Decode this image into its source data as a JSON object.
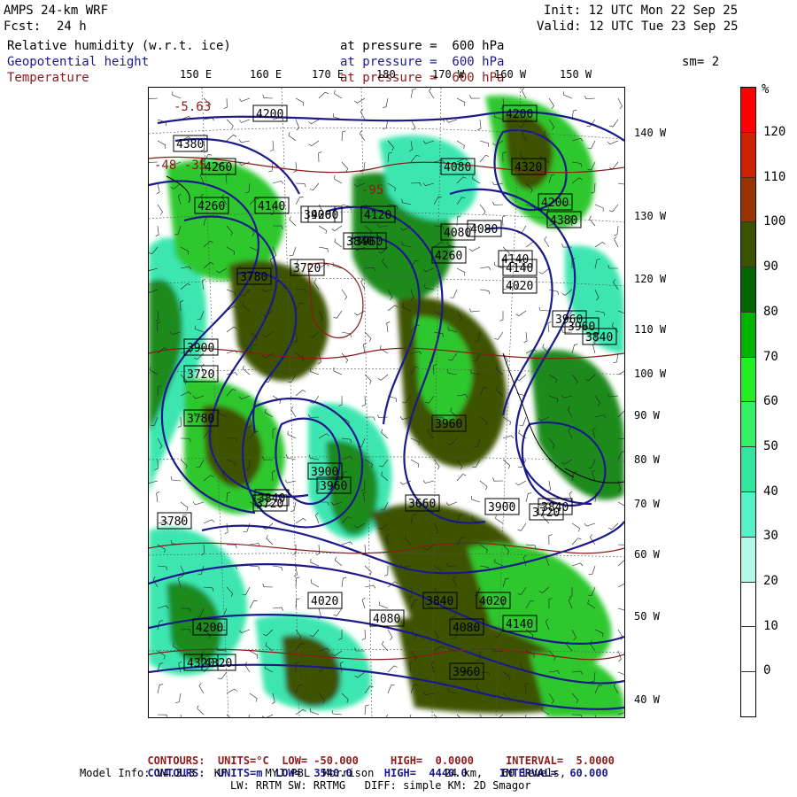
{
  "header": {
    "model": "AMPS 24-km WRF",
    "fcst_label": "Fcst:",
    "fcst_value": "24 h",
    "init": "Init: 12 UTC Mon 22 Sep 25",
    "valid": "Valid: 12 UTC Tue 23 Sep 25",
    "fields": [
      {
        "name": "Relative humidity (w.r.t. ice)",
        "level": "at pressure =  600 hPa",
        "color": "#000000"
      },
      {
        "name": "Geopotential height",
        "level": "at pressure =  600 hPa",
        "color": "#1a1a8c"
      },
      {
        "name": "Temperature",
        "level": "at pressure =  600 hPa",
        "color": "#8b1a1a"
      }
    ],
    "smoothing": "sm= 2"
  },
  "map": {
    "lon_labels": [
      "150 E",
      "160 E",
      "170 E",
      "180",
      "170 W",
      "160 W",
      "150 W"
    ],
    "lat_labels": [
      "140 W",
      "130 W",
      "120 W",
      "110 W",
      "100 W",
      "90 W",
      "80 W",
      "70 W",
      "60 W",
      "50 W",
      "40 W"
    ],
    "height_labels": [
      "4200",
      "4380",
      "4260",
      "4140",
      "4080",
      "4200",
      "4320",
      "4260",
      "4120",
      "3960",
      "3840",
      "3900",
      "3780",
      "3720",
      "4080",
      "4020",
      "4140",
      "3960",
      "3840",
      "3900",
      "3720",
      "3780",
      "3960",
      "3900",
      "3840",
      "3780",
      "3660",
      "3720",
      "3960",
      "4140",
      "4080",
      "3840",
      "3720",
      "3960",
      "3840",
      "3900",
      "3960",
      "4020",
      "4020",
      "4080",
      "4140",
      "4200",
      "4080",
      "4320",
      "4320",
      "4380",
      "4260",
      "4200",
      "4260"
    ],
    "temp_labels": [
      "-5.63",
      "-48",
      "-35",
      "-95"
    ],
    "colors": {
      "contour_height": "#1a1a8c",
      "contour_temp": "#8b1a1a",
      "rh_dark": "#3d5200",
      "rh_green": "#1e8b1e",
      "rh_light": "#2fc82f",
      "rh_cyan": "#3ee6b0",
      "rh_pale": "#b0f5e0"
    }
  },
  "colorbar": {
    "unit": "%",
    "labels": [
      "120",
      "110",
      "100",
      "90",
      "80",
      "70",
      "60",
      "50",
      "40",
      "30",
      "20",
      "10",
      "0"
    ],
    "segments": [
      "#ff0000",
      "#cc2200",
      "#993300",
      "#3d5200",
      "#006600",
      "#00b300",
      "#22ee22",
      "#33f066",
      "#33e6a0",
      "#55f0c8",
      "#b3f7e6",
      "#ffffff",
      "#ffffff",
      "#ffffff"
    ]
  },
  "footer": {
    "temp_line": {
      "prefix": "CONTOURS:",
      "units": "UNITS=°C",
      "low": "LOW= -50.000",
      "high": "HIGH=  0.0000",
      "interval": "INTERVAL=  5.0000"
    },
    "height_line": {
      "prefix": "CONTOURS:",
      "units": "UNITS=m",
      "low": "LOW=  3540.0",
      "high": "HIGH=  4440.0",
      "interval": "INTERVAL=  60.000"
    },
    "model_info_1": "Model Info: V4.3.3   KF      MYJ PBL  Morrison           24 km,   60 levels,",
    "model_info_2": "LW: RRTM SW: RRTMG   DIFF: simple KM: 2D Smagor"
  }
}
